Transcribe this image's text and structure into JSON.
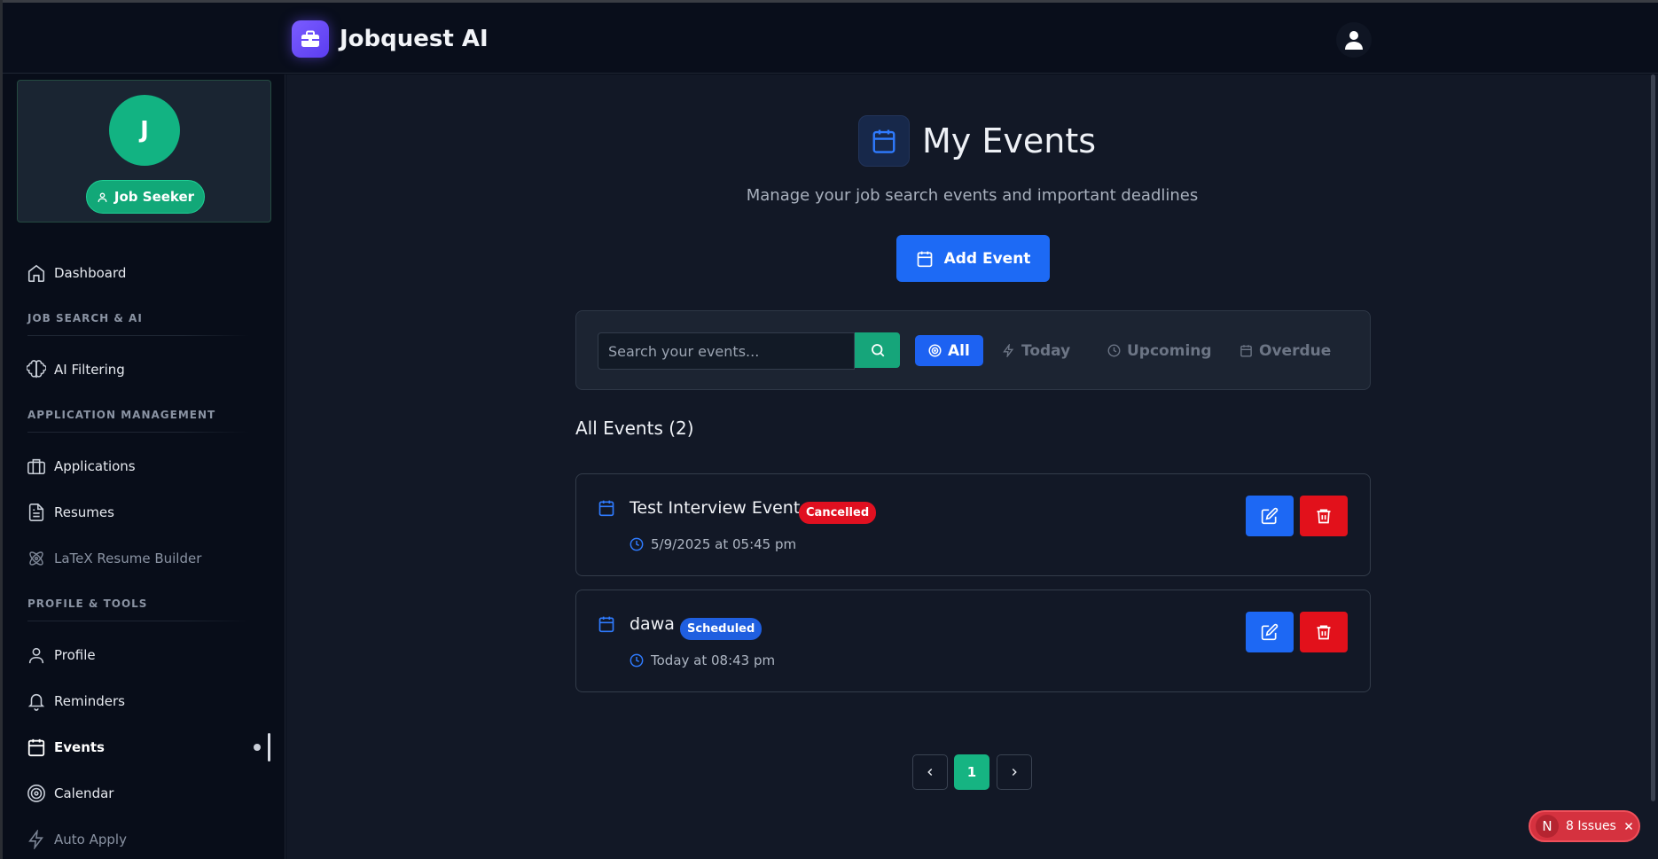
{
  "app": {
    "title": "Jobquest AI"
  },
  "sidebar": {
    "profile": {
      "avatar_letter": "J",
      "role": "Job Seeker"
    },
    "dashboard": "Dashboard",
    "sections": [
      {
        "label": "JOB SEARCH & AI",
        "items": [
          "AI Filtering"
        ]
      },
      {
        "label": "APPLICATION MANAGEMENT",
        "items": [
          "Applications",
          "Resumes",
          "LaTeX Resume Builder"
        ]
      },
      {
        "label": "PROFILE & TOOLS",
        "items": [
          "Profile",
          "Reminders",
          "Events",
          "Calendar",
          "Auto Apply"
        ]
      }
    ],
    "active_item": "Events"
  },
  "main": {
    "title": "My Events",
    "subtitle": "Manage your job search events and important deadlines",
    "add_button": "Add Event",
    "search_placeholder": "Search your events...",
    "filters": [
      "All",
      "Today",
      "Upcoming",
      "Overdue"
    ],
    "active_filter": "All",
    "section_title": "All Events (2)",
    "events": [
      {
        "title": "Test Interview Event",
        "status": "Cancelled",
        "time": "5/9/2025 at 05:45 pm"
      },
      {
        "title": "dawa",
        "status": "Scheduled",
        "time": "Today at 08:43 pm"
      }
    ],
    "pagination": {
      "current": "1"
    }
  },
  "dev_overlay": {
    "badge_letter": "N",
    "issues": "8 Issues"
  },
  "colors": {
    "accent_blue": "#1d6af5",
    "accent_green": "#16b482",
    "danger": "#e2111b"
  }
}
